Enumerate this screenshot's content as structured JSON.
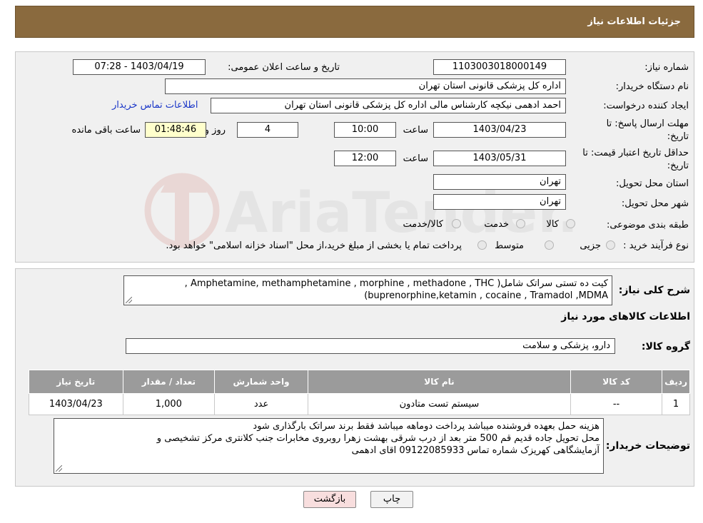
{
  "header": {
    "title": "جزئیات اطلاعات نیاز"
  },
  "watermark": {
    "text": "AriaTender.neT"
  },
  "form": {
    "need_number_label": "شماره نیاز:",
    "need_number": "1103003018000149",
    "announce_label": "تاریخ و ساعت اعلان عمومی:",
    "announce_value": "1403/04/19 - 07:28",
    "buyer_org_label": "نام دستگاه خریدار:",
    "buyer_org": "اداره کل پزشکی قانونی استان تهران",
    "creator_label": "ایجاد کننده درخواست:",
    "creator": "احمد ادهمی نیکچه کارشناس مالی اداره کل پزشکی قانونی استان تهران",
    "contact_link": "اطلاعات تماس خریدار",
    "deadline_label_1": "مهلت ارسال پاسخ: تا",
    "deadline_label_2": "تاریخ:",
    "deadline_date": "1403/04/23",
    "time_label": "ساعت",
    "deadline_time": "10:00",
    "days": "4",
    "days_label": "روز و",
    "remaining_time": "01:48:46",
    "remaining_label": "ساعت باقی مانده",
    "price_valid_label_1": "حداقل تاریخ اعتبار قیمت: تا",
    "price_valid_label_2": "تاریخ:",
    "price_valid_date": "1403/05/31",
    "price_valid_time": "12:00",
    "province_label": "استان محل تحویل:",
    "province": "تهران",
    "city_label": "شهر محل تحویل:",
    "city": "تهران",
    "category_label": "طبقه بندی موضوعی:",
    "category_options": [
      "کالا",
      "خدمت",
      "کالا/خدمت"
    ],
    "purchase_type_label": "نوع فرآیند خرید :",
    "purchase_options": [
      "جزیی",
      "متوسط"
    ],
    "purchase_note": "پرداخت تمام یا بخشی از مبلغ خرید،از محل \"اسناد خزانه اسلامی\" خواهد بود."
  },
  "details": {
    "summary_label": "شرح کلی نیاز:",
    "summary_line1": "کیت ده تستی سراتک شامل( Amphetamine, methamphetamine , morphine , methadone , THC ,",
    "summary_line2": "buprenorphine,ketamin , cocaine , Tramadol ,MDMA)",
    "goods_info_title": "اطلاعات کالاهای مورد نیاز",
    "goods_group_label": "گروه کالا:",
    "goods_group": "دارو، پزشکی و سلامت",
    "table": {
      "headers": [
        "ردیف",
        "کد کالا",
        "نام کالا",
        "واحد شمارش",
        "تعداد / مقدار",
        "تاریخ نیاز"
      ],
      "rows": [
        [
          "1",
          "--",
          "سیستم تست متادون",
          "عدد",
          "1,000",
          "1403/04/23"
        ]
      ]
    },
    "buyer_notes_label": "توضیحات خریدار:",
    "buyer_notes_line1": "هزینه حمل بعهده فروشنده میباشد پرداخت دوماهه میباشد فقط برند سراتک بارگذاری شود",
    "buyer_notes_line2": "محل تحویل جاده قدیم قم 500 متر بعد از درب شرقی بهشت زهرا روبروی مخابرات جنب کلانتری مرکز تشخیصی و",
    "buyer_notes_line3": "آزمایشگاهی کهریزک شماره تماس 09122085933 اقای ادهمی"
  },
  "buttons": {
    "print": "چاپ",
    "back": "بازگشت"
  },
  "colors": {
    "header_bg": "#8a6a3e",
    "panel_bg": "#f0f0f0",
    "table_header_bg": "#9b9b9b",
    "link": "#1a36c8",
    "back_button_bg": "#f8dede"
  }
}
